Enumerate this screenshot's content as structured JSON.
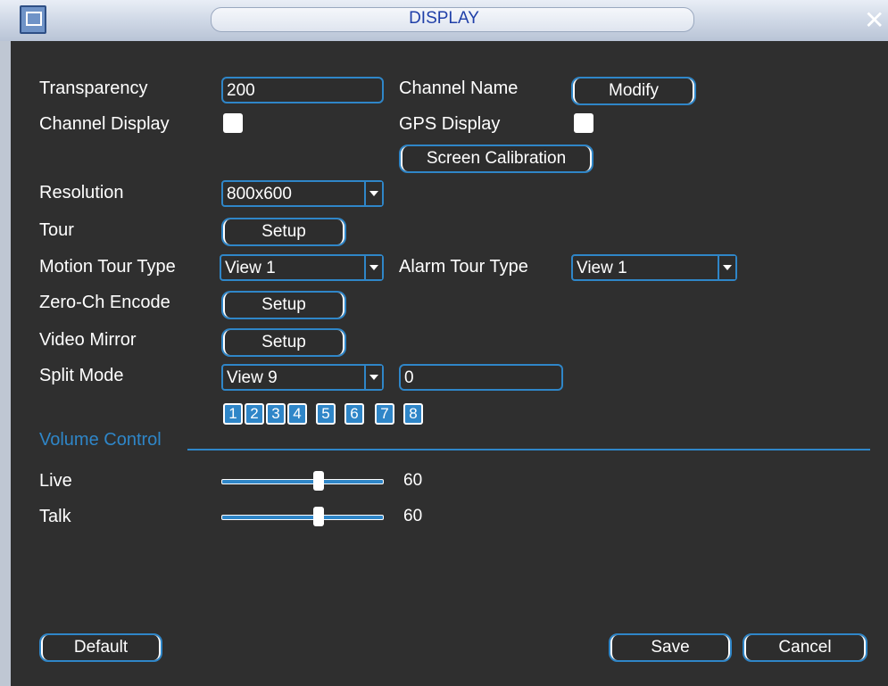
{
  "window": {
    "title": "DISPLAY"
  },
  "labels": {
    "transparency": "Transparency",
    "channel_name": "Channel Name",
    "channel_display": "Channel Display",
    "gps_display": "GPS Display",
    "resolution": "Resolution",
    "tour": "Tour",
    "motion_tour_type": "Motion Tour Type",
    "alarm_tour_type": "Alarm Tour Type",
    "zero_ch_encode": "Zero-Ch Encode",
    "video_mirror": "Video Mirror",
    "split_mode": "Split Mode",
    "volume_control": "Volume Control",
    "live": "Live",
    "talk": "Talk"
  },
  "values": {
    "transparency": "200",
    "resolution": "800x600",
    "motion_tour_type": "View 1",
    "alarm_tour_type": "View 1",
    "split_mode": "View 9",
    "split_channel": "0",
    "live_volume": "60",
    "talk_volume": "60"
  },
  "buttons": {
    "modify": "Modify",
    "screen_calibration": "Screen Calibration",
    "tour_setup": "Setup",
    "zero_ch_setup": "Setup",
    "video_mirror_setup": "Setup",
    "default": "Default",
    "save": "Save",
    "cancel": "Cancel"
  },
  "channel_buttons": [
    "1",
    "2",
    "3",
    "4",
    "5",
    "6",
    "7",
    "8"
  ],
  "checkboxes": {
    "channel_display": false,
    "gps_display": false
  },
  "sliders": {
    "live_level": 0.6,
    "talk_level": 0.6
  },
  "colors": {
    "accent": "#2f86c8",
    "background": "#2f2f2f",
    "title": "#1f3fa8"
  },
  "icons": {
    "window": "window-icon",
    "close": "close-icon"
  }
}
